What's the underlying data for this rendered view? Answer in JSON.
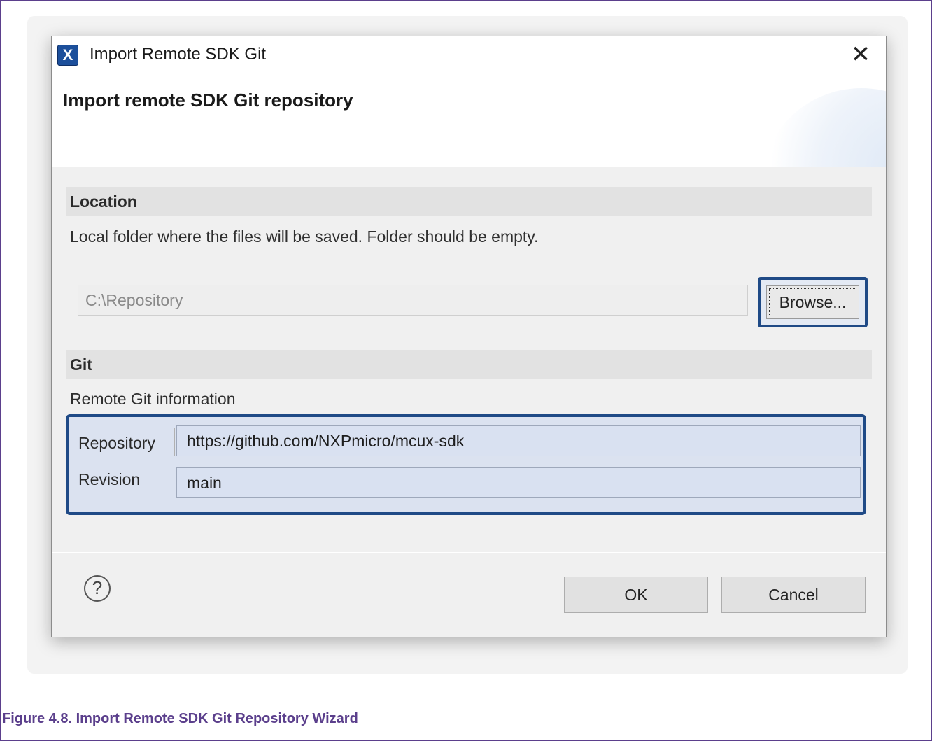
{
  "dialog": {
    "window_title": "Import Remote SDK Git",
    "app_icon_glyph": "X",
    "close_glyph": "✕",
    "banner_title": "Import remote SDK Git repository"
  },
  "location": {
    "header": "Location",
    "description": "Local folder where the files will be saved. Folder should be empty.",
    "path_value": "C:\\Repository",
    "browse_label": "Browse..."
  },
  "git": {
    "header": "Git",
    "description": "Remote Git information",
    "repository_label": "Repository",
    "repository_value": "https://github.com/NXPmicro/mcux-sdk",
    "revision_label": "Revision",
    "revision_value": "main"
  },
  "buttons": {
    "help_glyph": "?",
    "ok_label": "OK",
    "cancel_label": "Cancel"
  },
  "caption": "Figure 4.8. Import Remote SDK Git Repository Wizard",
  "colors": {
    "accent_border": "#1f4a86",
    "caption_color": "#5b3f8c",
    "git_group_bg": "#dbe2f0"
  }
}
